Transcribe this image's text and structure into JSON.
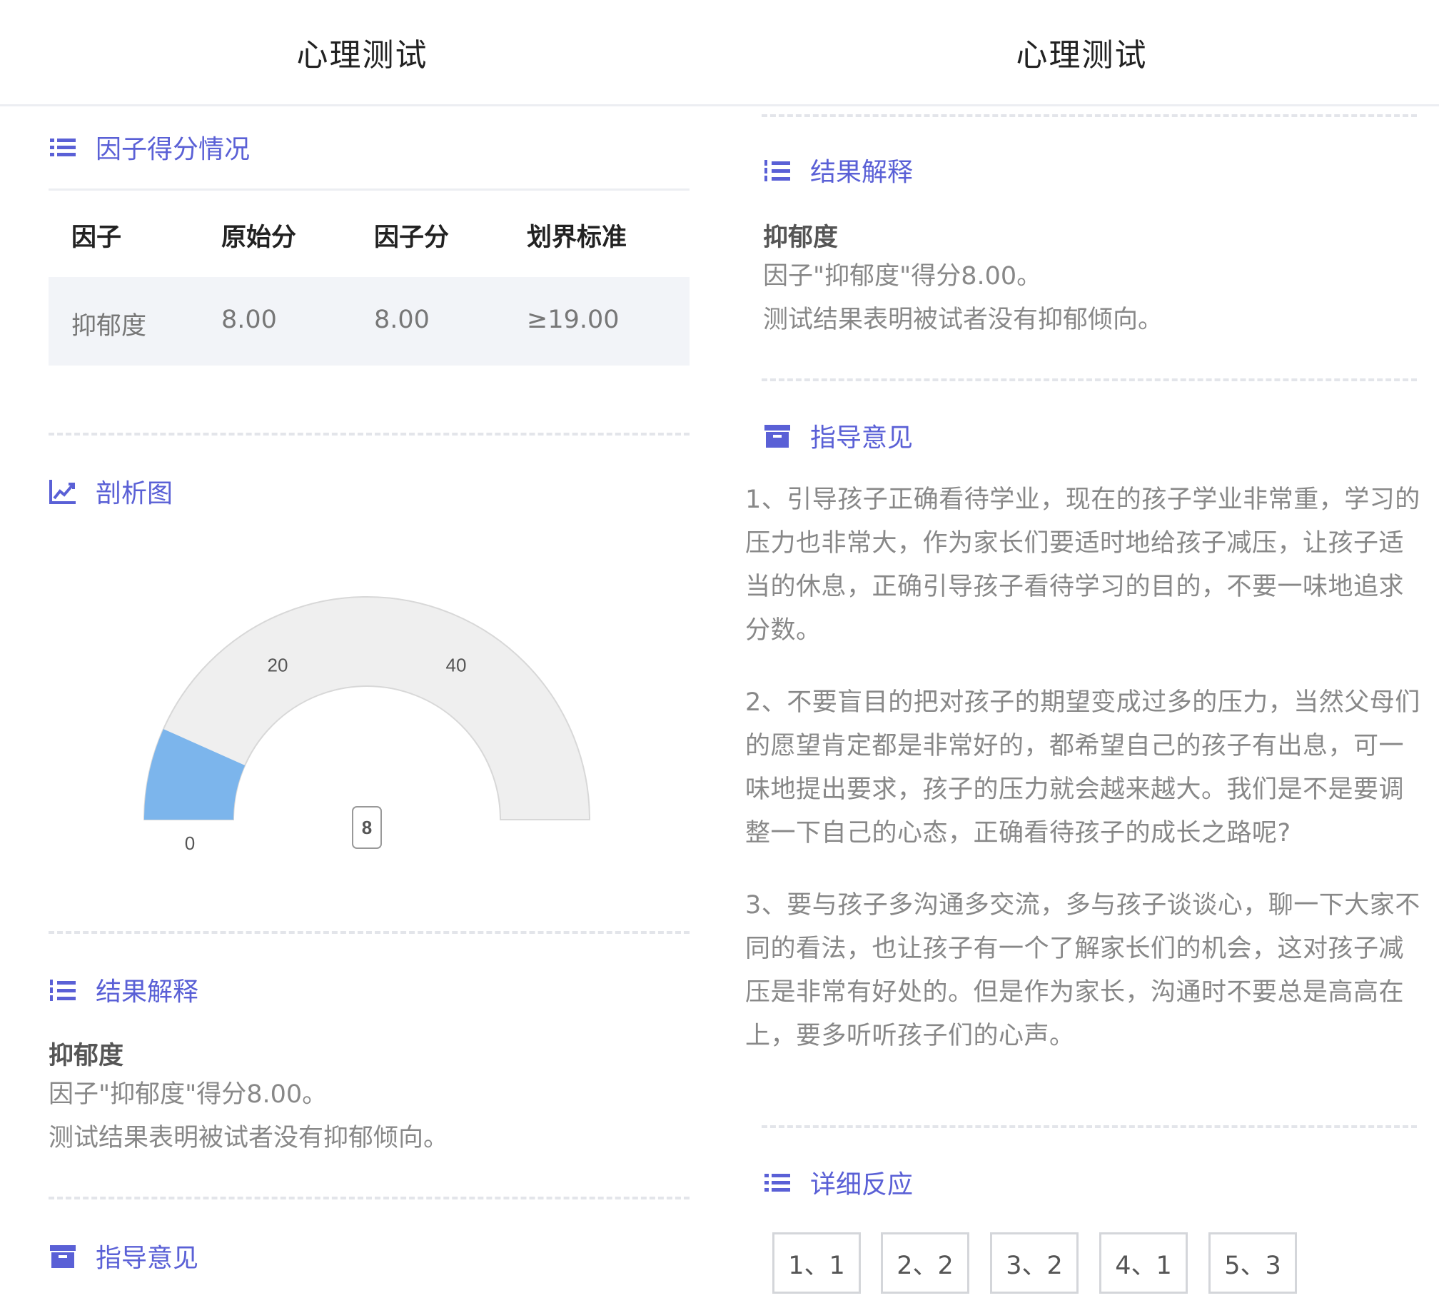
{
  "left": {
    "header_title": "心理测试",
    "factor_section_title": "因子得分情况",
    "table": {
      "headers": [
        "因子",
        "原始分",
        "因子分",
        "划界标准"
      ],
      "rows": [
        [
          "抑郁度",
          "8.00",
          "8.00",
          "≥19.00"
        ]
      ]
    },
    "chart_section_title": "剖析图",
    "result_section_title": "结果解释",
    "result_factor": "抑郁度",
    "result_line1": "因子\"抑郁度\"得分8.00。",
    "result_line2": "测试结果表明被试者没有抑郁倾向。",
    "guide_section_title": "指导意见"
  },
  "right": {
    "header_title": "心理测试",
    "result_section_title": "结果解释",
    "result_factor": "抑郁度",
    "result_line1": "因子\"抑郁度\"得分8.00。",
    "result_line2": "测试结果表明被试者没有抑郁倾向。",
    "guide_section_title": "指导意见",
    "guide_paragraphs": [
      "1、引导孩子正确看待学业，现在的孩子学业非常重，学习的压力也非常大，作为家长们要适时地给孩子减压，让孩子适当的休息，正确引导孩子看待学习的目的，不要一味地追求分数。",
      "2、不要盲目的把对孩子的期望变成过多的压力，当然父母们的愿望肯定都是非常好的，都希望自己的孩子有出息，可一味地提出要求，孩子的压力就会越来越大。我们是不是要调整一下自己的心态，正确看待孩子的成长之路呢?",
      "3、要与孩子多沟通多交流，多与孩子谈谈心，聊一下大家不同的看法，也让孩子有一个了解家长们的机会，这对孩子减压是非常有好处的。但是作为家长，沟通时不要总是高高在上，要多听听孩子们的心声。"
    ],
    "detail_section_title": "详细反应",
    "responses": [
      "1、1",
      "2、2",
      "3、2",
      "4、1",
      "5、3"
    ]
  },
  "colors": {
    "accent": "#5a60d6",
    "gauge_fill": "#7cb5ec",
    "gauge_track": "#efefef"
  },
  "chart_data": {
    "type": "gauge",
    "min": 0,
    "max": 60,
    "value": 8,
    "value_label": "8",
    "ticks": [
      {
        "value": 0,
        "label": "0"
      },
      {
        "value": 20,
        "label": "20"
      },
      {
        "value": 40,
        "label": "40"
      }
    ]
  }
}
